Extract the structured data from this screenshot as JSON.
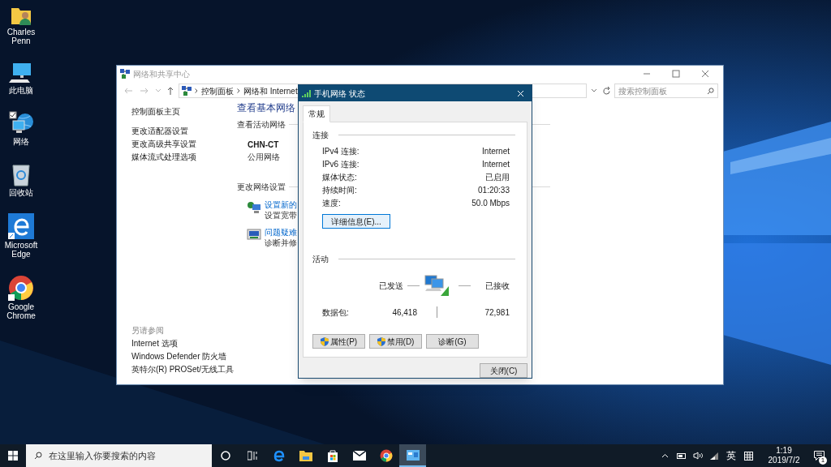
{
  "desktop_icons": [
    {
      "label": "Charles Penn"
    },
    {
      "label": "此电脑"
    },
    {
      "label": "网络"
    },
    {
      "label": "回收站"
    },
    {
      "label": "Microsoft Edge"
    },
    {
      "label": "Google Chrome"
    }
  ],
  "explorer": {
    "title": "网络和共享中心",
    "breadcrumb": [
      "控制面板",
      "网络和 Internet"
    ],
    "search": {
      "placeholder": "搜索控制面板"
    },
    "sidebar": {
      "home": "控制面板主页",
      "links": [
        "更改适配器设置",
        "更改高级共享设置",
        "媒体流式处理选项"
      ],
      "see_also_title": "另请参阅",
      "see_also": [
        "Internet 选项",
        "Windows Defender 防火墙",
        "英特尔(R) PROSet/无线工具"
      ]
    },
    "heading": "查看基本网络",
    "active_networks": {
      "title": "查看活动网络",
      "name": "CHN-CT",
      "type": "公用网络"
    },
    "change_settings": {
      "title": "更改网络设置",
      "tasks": [
        {
          "link": "设置新的",
          "description": "设置宽带"
        },
        {
          "link": "问题疑难",
          "description": "诊断并修"
        }
      ]
    }
  },
  "dialog": {
    "title": "手机网络 状态",
    "tabs": [
      {
        "label": "常规",
        "selected": true
      }
    ],
    "connection": {
      "title": "连接",
      "rows": [
        {
          "label": "IPv4 连接:",
          "value": "Internet"
        },
        {
          "label": "IPv6 连接:",
          "value": "Internet"
        },
        {
          "label": "媒体状态:",
          "value": "已启用"
        },
        {
          "label": "持续时间:",
          "value": "01:20:33"
        },
        {
          "label": "速度:",
          "value": "50.0 Mbps"
        }
      ]
    },
    "details_button": "详细信息(E)...",
    "activity": {
      "title": "活动",
      "sent_label": "已发送",
      "received_label": "已接收",
      "packets_label": "数据包:",
      "sent": "46,418",
      "received": "72,981"
    },
    "buttons": [
      {
        "label": "属性(P)",
        "shield": true
      },
      {
        "label": "禁用(D)",
        "shield": true
      },
      {
        "label": "诊断(G)",
        "shield": false
      }
    ],
    "close_button": "关闭(C)"
  },
  "taskbar": {
    "search": {
      "placeholder": "在这里输入你要搜索的内容"
    },
    "apps": [
      {
        "active": false
      },
      {
        "active": false
      },
      {
        "active": false
      },
      {
        "active": false
      },
      {
        "active": false
      },
      {
        "active": true
      }
    ],
    "tray": {
      "input_language": "英",
      "time": "1:19",
      "date": "2019/7/2",
      "notification_count": "1"
    }
  }
}
